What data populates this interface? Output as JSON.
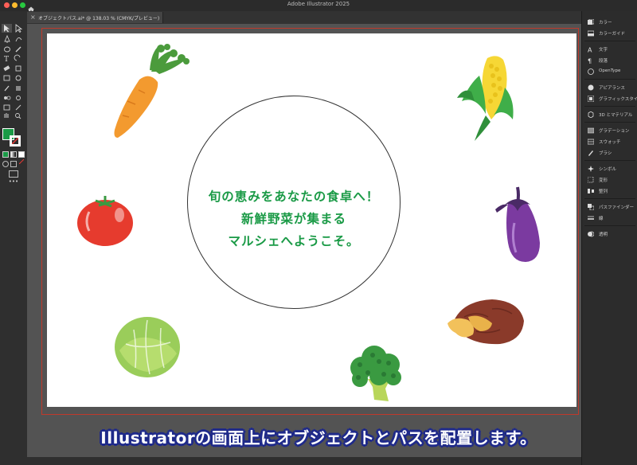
{
  "app": {
    "title": "Adobe Illustrator 2025",
    "traffic_lights": [
      "#ff5f57",
      "#febc2e",
      "#28c840"
    ]
  },
  "document_tab": {
    "close": "×",
    "title": "オブジェクトパス.ai* @ 138.03 % (CMYK/プレビュー)"
  },
  "artboard": {
    "center_text": [
      "旬の恵みをあなたの食卓へ！",
      "新鮮野菜が集まる",
      "マルシェへようこそ。"
    ],
    "text_color": "#1a9a46",
    "vegetables": [
      "carrot",
      "corn",
      "tomato",
      "eggplant",
      "sweet-potato",
      "cabbage",
      "broccoli"
    ]
  },
  "toolbar": {
    "fill_color": "#1a9a46",
    "stroke_color": "#ffffff",
    "more": "•••"
  },
  "panels": [
    {
      "icon": "color-icon",
      "label": "カラー"
    },
    {
      "icon": "color-guide-icon",
      "label": "カラーガイド"
    },
    {
      "icon": "character-icon",
      "label": "文字"
    },
    {
      "icon": "paragraph-icon",
      "label": "段落"
    },
    {
      "icon": "opentype-icon",
      "label": "OpenType"
    },
    {
      "icon": "appearance-icon",
      "label": "アピアランス"
    },
    {
      "icon": "graphic-styles-icon",
      "label": "グラフィックスタイル"
    },
    {
      "icon": "3d-materials-icon",
      "label": "3D とマテリアル"
    },
    {
      "icon": "gradient-icon",
      "label": "グラデーション"
    },
    {
      "icon": "swatches-icon",
      "label": "スウォッチ"
    },
    {
      "icon": "brushes-icon",
      "label": "ブラシ"
    },
    {
      "icon": "symbols-icon",
      "label": "シンボル"
    },
    {
      "icon": "transform-icon",
      "label": "変形"
    },
    {
      "icon": "align-icon",
      "label": "整列"
    },
    {
      "icon": "pathfinder-icon",
      "label": "パスファインダー"
    },
    {
      "icon": "stroke-icon",
      "label": "線"
    },
    {
      "icon": "transparency-icon",
      "label": "透明"
    }
  ],
  "caption": "Illustratorの画面上にオブジェクトとパスを配置します。"
}
